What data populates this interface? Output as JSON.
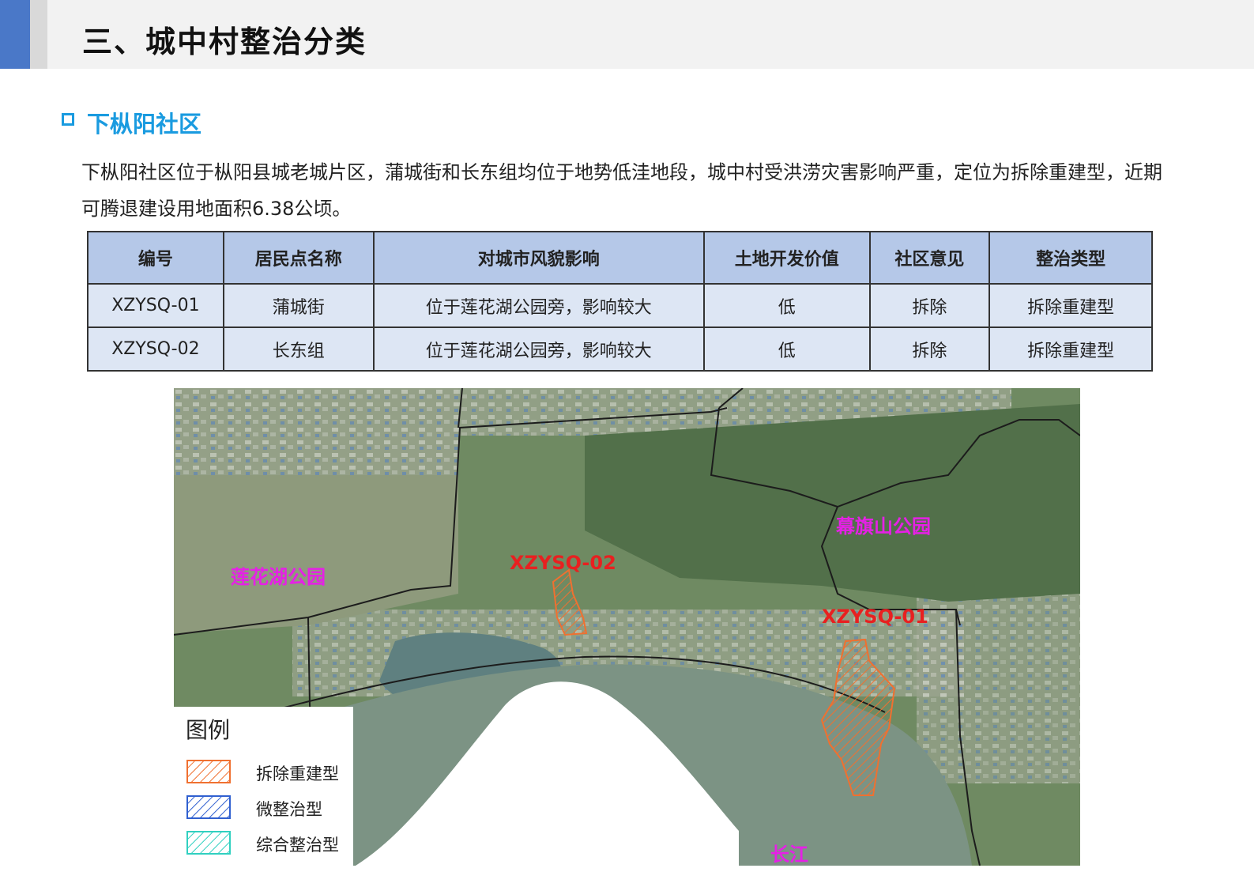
{
  "header": {
    "title": "三、城中村整治分类"
  },
  "section": {
    "title": "下枞阳社区",
    "intro": "下枞阳社区位于枞阳县城老城片区，蒲城街和长东组均位于地势低洼地段，城中村受洪涝灾害影响严重，定位为拆除重建型，近期可腾退建设用地面积6.38公顷。"
  },
  "table": {
    "headers": [
      "编号",
      "居民点名称",
      "对城市风貌影响",
      "土地开发价值",
      "社区意见",
      "整治类型"
    ],
    "rows": [
      [
        "XZYSQ-01",
        "蒲城街",
        "位于莲花湖公园旁，影响较大",
        "低",
        "拆除",
        "拆除重建型"
      ],
      [
        "XZYSQ-02",
        "长东组",
        "位于莲花湖公园旁，影响较大",
        "低",
        "拆除",
        "拆除重建型"
      ]
    ]
  },
  "map": {
    "labels": {
      "lianhuahu": "莲花湖公园",
      "muqishan": "幕旗山公园",
      "changjiang": "长江",
      "site01": "XZYSQ-01",
      "site02": "XZYSQ-02"
    },
    "legend": {
      "title": "图例",
      "items": [
        {
          "label": "拆除重建型",
          "color": "#f07030"
        },
        {
          "label": "微整治型",
          "color": "#3060d0"
        },
        {
          "label": "综合整治型",
          "color": "#30d0c0"
        }
      ]
    }
  },
  "colors": {
    "accent_blue": "#1a9be0",
    "header_bar": "#4a78c8",
    "park_label": "#e620e6",
    "site_label": "#e82020"
  }
}
